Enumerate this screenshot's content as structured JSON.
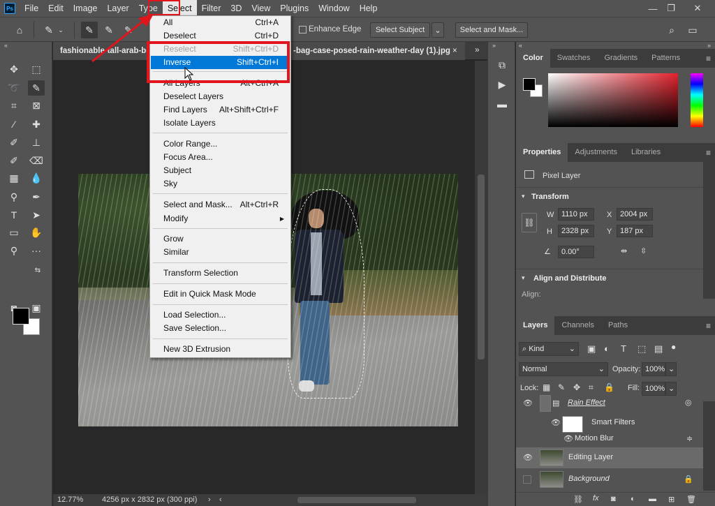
{
  "app": {
    "logo": "Ps"
  },
  "menubar": [
    "File",
    "Edit",
    "Image",
    "Layer",
    "Type",
    "Select",
    "Filter",
    "3D",
    "View",
    "Plugins",
    "Window",
    "Help"
  ],
  "window_controls": {
    "minimize": "—",
    "restore": "❐",
    "close": "✕"
  },
  "options_bar": {
    "enhance_edge": "Enhance Edge",
    "select_subject": "Select Subject",
    "select_and_mask": "Select and Mask..."
  },
  "document": {
    "tab_left": "fashionable-tall-arab-be",
    "tab_right": "-bag-case-posed-rain-weather-day (1).jpg",
    "tab_close": "×",
    "zoom": "12.77%",
    "dimensions": "4256 px x 2832 px (300 ppi)"
  },
  "select_menu": {
    "items": [
      {
        "label": "All",
        "shortcut": "Ctrl+A"
      },
      {
        "label": "Deselect",
        "shortcut": "Ctrl+D"
      },
      {
        "label": "Reselect",
        "shortcut": "Shift+Ctrl+D",
        "disabled": true
      },
      {
        "label": "Inverse",
        "shortcut": "Shift+Ctrl+I",
        "highlighted": true
      },
      {
        "label": "All Layers",
        "shortcut": "Alt+Ctrl+A"
      },
      {
        "label": "Deselect Layers",
        "shortcut": ""
      },
      {
        "label": "Find Layers",
        "shortcut": "Alt+Shift+Ctrl+F"
      },
      {
        "label": "Isolate Layers",
        "shortcut": ""
      },
      {
        "label": "Color Range...",
        "shortcut": ""
      },
      {
        "label": "Focus Area...",
        "shortcut": ""
      },
      {
        "label": "Subject",
        "shortcut": ""
      },
      {
        "label": "Sky",
        "shortcut": ""
      },
      {
        "label": "Select and Mask...",
        "shortcut": "Alt+Ctrl+R"
      },
      {
        "label": "Modify",
        "shortcut": ""
      },
      {
        "label": "Grow",
        "shortcut": ""
      },
      {
        "label": "Similar",
        "shortcut": ""
      },
      {
        "label": "Transform Selection",
        "shortcut": ""
      },
      {
        "label": "Edit in Quick Mask Mode",
        "shortcut": ""
      },
      {
        "label": "Load Selection...",
        "shortcut": ""
      },
      {
        "label": "Save Selection...",
        "shortcut": ""
      },
      {
        "label": "New 3D Extrusion",
        "shortcut": ""
      }
    ]
  },
  "color_panel": {
    "tabs": [
      "Color",
      "Swatches",
      "Gradients",
      "Patterns"
    ]
  },
  "properties_panel": {
    "tabs": [
      "Properties",
      "Adjustments",
      "Libraries"
    ],
    "kind": "Pixel Layer",
    "transform_title": "Transform",
    "w_label": "W",
    "w_value": "1110 px",
    "h_label": "H",
    "h_value": "2328 px",
    "x_label": "X",
    "x_value": "2004 px",
    "y_label": "Y",
    "y_value": "187 px",
    "angle_value": "0.00°",
    "align_title": "Align and Distribute",
    "align_label": "Align:"
  },
  "layers_panel": {
    "tabs": [
      "Layers",
      "Channels",
      "Paths"
    ],
    "filter_kind": "Kind",
    "blend_mode": "Normal",
    "opacity_label": "Opacity:",
    "opacity_value": "100%",
    "lock_label": "Lock:",
    "fill_label": "Fill:",
    "fill_value": "100%",
    "layers": [
      "Rain Effect",
      "Smart Filters",
      "Motion Blur",
      "Editing Layer",
      "Background"
    ]
  }
}
